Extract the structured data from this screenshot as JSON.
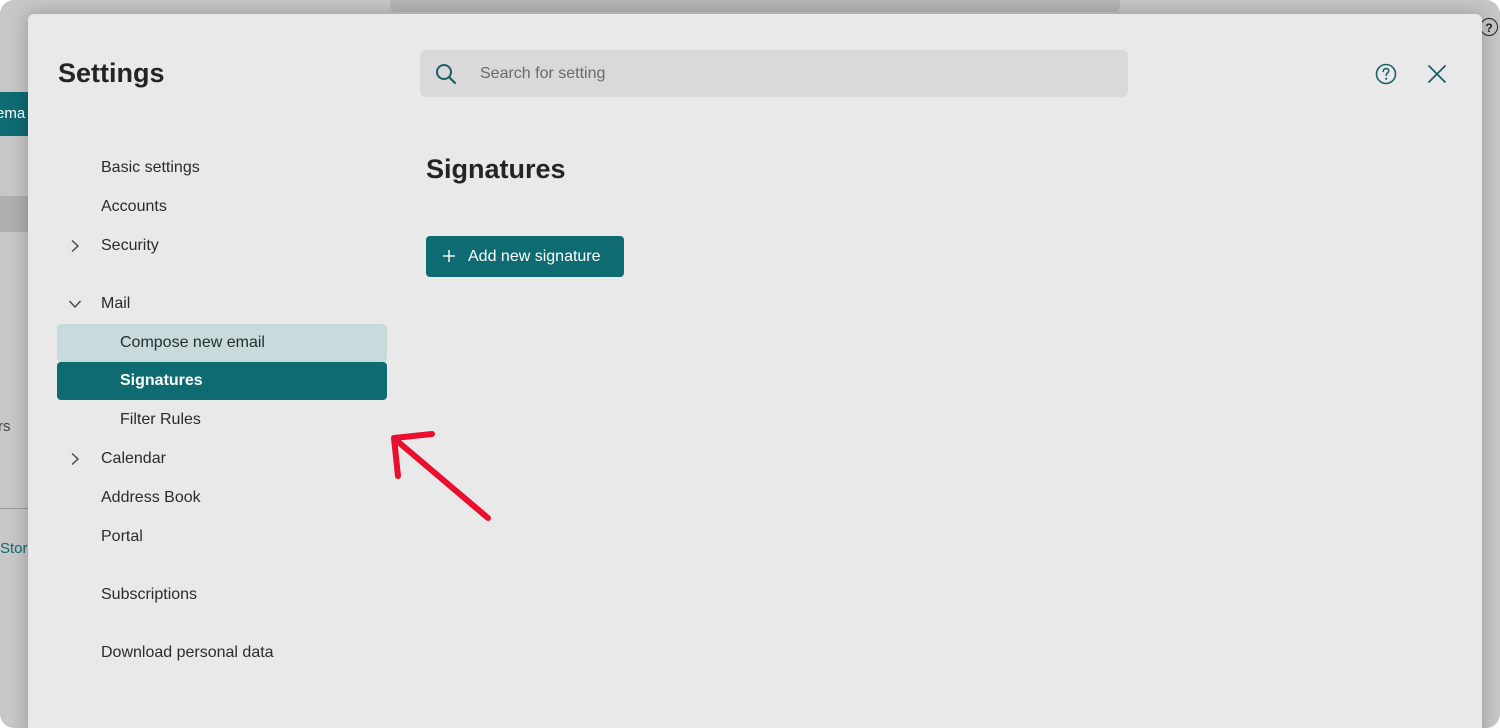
{
  "background": {
    "left_button_text": "ema",
    "left_text_1": "rs",
    "left_text_2": "Stor",
    "help_glyph": "?"
  },
  "settings": {
    "title": "Settings",
    "search": {
      "placeholder": "Search for setting",
      "value": ""
    },
    "nav": [
      {
        "label": "Basic settings",
        "chevron": "none"
      },
      {
        "label": "Accounts",
        "chevron": "none"
      },
      {
        "label": "Security",
        "chevron": "right"
      },
      {
        "label": "Mail",
        "chevron": "down"
      },
      {
        "label": "Compose new email",
        "indent": true,
        "state": "hover"
      },
      {
        "label": "Signatures",
        "indent": true,
        "state": "selected"
      },
      {
        "label": "Filter Rules",
        "indent": true
      },
      {
        "label": "Calendar",
        "chevron": "right"
      },
      {
        "label": "Address Book",
        "chevron": "none"
      },
      {
        "label": "Portal",
        "chevron": "none"
      },
      {
        "label": "Subscriptions",
        "chevron": "none"
      },
      {
        "label": "Download personal data",
        "chevron": "none"
      }
    ],
    "content": {
      "section_title": "Signatures",
      "add_button_label": "Add new signature"
    },
    "icons": {
      "search": "search-icon",
      "help": "help-circle-icon",
      "close": "close-icon",
      "plus": "plus-icon",
      "chevron_right": "chevron-right-icon",
      "chevron_down": "chevron-down-icon"
    }
  },
  "annotation": {
    "type": "red-arrow",
    "color": "#e8102e"
  },
  "colors": {
    "accent": "#0f6b72",
    "accent_light": "#c7dbdd",
    "panel_bg": "#e9e9e9",
    "search_bg": "#d9d9d9"
  }
}
